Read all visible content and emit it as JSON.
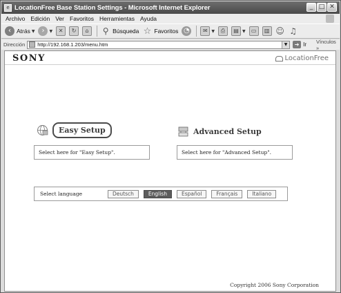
{
  "window": {
    "title": "LocationFree Base Station Settings - Microsoft Internet Explorer",
    "controls": {
      "minimize": "_",
      "maximize": "□",
      "close": "✕"
    }
  },
  "menubar": {
    "items": [
      "Archivo",
      "Edición",
      "Ver",
      "Favoritos",
      "Herramientas",
      "Ayuda"
    ]
  },
  "toolbar": {
    "back_label": "Atrás",
    "search_label": "Búsqueda",
    "favorites_label": "Favoritos"
  },
  "addressbar": {
    "label": "Dirección",
    "url": "http://192.168.1.203/menu.htm",
    "go_label": "Ir",
    "links_label": "Vínculos »"
  },
  "page": {
    "brand": "SONY",
    "product_logo": "LocationFree",
    "easy_setup": {
      "title": "Easy Setup",
      "description": "Select here for \"Easy Setup\"."
    },
    "advanced_setup": {
      "title": "Advanced Setup",
      "description": "Select here for \"Advanced Setup\"."
    },
    "language": {
      "label": "Select language",
      "options": [
        "Deutsch",
        "English",
        "Español",
        "Français",
        "Italiano"
      ],
      "selected": "English"
    },
    "copyright": "Copyright 2006 Sony Corporation"
  },
  "colors": {
    "titlebar": "#555555",
    "active_language_bg": "#5c5c5c"
  }
}
